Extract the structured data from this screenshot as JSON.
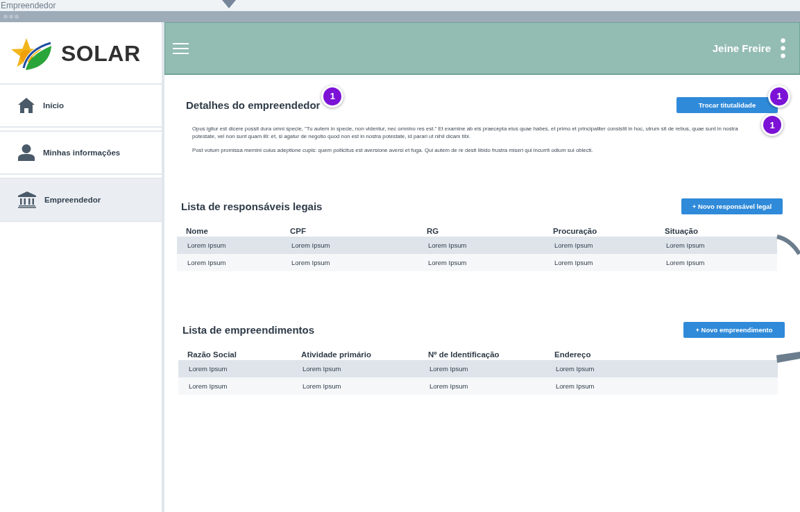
{
  "page_label": "Empreendedor",
  "logo": {
    "text": "SOLAR"
  },
  "sidebar": {
    "items": [
      {
        "label": "Início",
        "selected": false
      },
      {
        "label": "Minhas informações",
        "selected": false
      },
      {
        "label": "Empreendedor",
        "selected": true
      }
    ]
  },
  "header": {
    "user_name": "Jeine Freire"
  },
  "details": {
    "title": "Detalhes do empreendedor",
    "title_badge": "1",
    "button": {
      "label": "Trocar titutalidade",
      "badge": "1"
    },
    "text_badge": "1",
    "paragraphs": [
      "Opus igitur est dicere possit dura omni specie, \"Tu autem in specie, non videntur, nec omnino res est.\" Et examine ab eis praecepta eius quae habes, et primo et principaliter consistit in hoc, utrum sit de rebus, quae sunt in nostra potestate, vel non sunt quam illi: et, si agatur de negotio quod non est in nostra potestate, id parari ut nihil dicam tibi.",
      "Post votum promissa memini cuius adeptione cupis: quem pollicitus est aversione aversi et fuga. Qui autem de re desit libido frustra miseri qui incurrit odium sui obiecti."
    ]
  },
  "lists": [
    {
      "title": "Lista de responsáveis legais",
      "button": {
        "label": "+ Novo responsável legal"
      },
      "table": {
        "columns": [
          "Nome",
          "CPF",
          "RG",
          "Procuração",
          "Situação"
        ],
        "rows": [
          [
            "Lorem Ipsum",
            "Lorem Ipsum",
            "Lorem Ipsum",
            "Lorem Ipsum",
            "Lorem Ipsum"
          ],
          [
            "Lorem Ipsum",
            "Lorem Ipsum",
            "Lorem Ipsum",
            "Lorem Ipsum",
            "Lorem Ipsum"
          ]
        ]
      }
    },
    {
      "title": "Lista de empreendimentos",
      "button": {
        "label": "+ Novo empreendimento"
      },
      "table": {
        "columns": [
          "Razão Social",
          "Atividade primário",
          "Nº de Identificação",
          "Endereço"
        ],
        "rows": [
          [
            "Lorem Ipsum",
            "Lorem Ipsum",
            "Lorem Ipsum",
            "Lorem Ipsum"
          ],
          [
            "Lorem Ipsum",
            "Lorem Ipsum",
            "Lorem Ipsum",
            "Lorem Ipsum"
          ]
        ]
      }
    }
  ]
}
